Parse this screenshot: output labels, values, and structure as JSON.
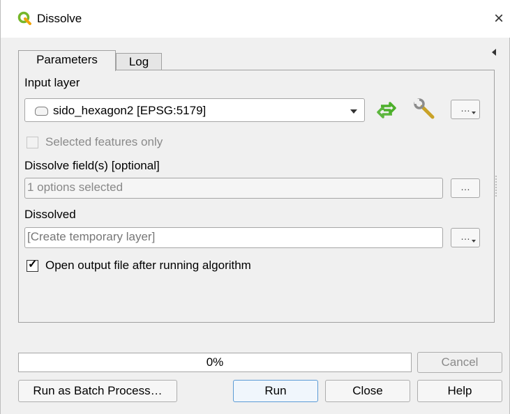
{
  "window": {
    "title": "Dissolve",
    "close_glyph": "×"
  },
  "tabs": [
    {
      "label": "Parameters",
      "active": true
    },
    {
      "label": "Log",
      "active": false
    }
  ],
  "params": {
    "input_layer_label": "Input layer",
    "input_layer_value": "sido_hexagon2 [EPSG:5179]",
    "selected_only_label": "Selected features only",
    "dissolve_field_label": "Dissolve field(s) [optional]",
    "dissolve_field_value": "1 options selected",
    "dissolved_label": "Dissolved",
    "dissolved_value": "[Create temporary layer]",
    "open_output_label": "Open output file after running algorithm",
    "dots": "…"
  },
  "footer": {
    "progress_percent": 0,
    "progress_text": "0%",
    "cancel_label": "Cancel",
    "batch_label": "Run as Batch Process…",
    "run_label": "Run",
    "close_label": "Close",
    "help_label": "Help"
  },
  "colors": {
    "qgis_green": "#76b72a",
    "accent_blue": "#5b9bd5"
  },
  "icons": [
    "qgis-logo-icon",
    "close-icon",
    "layer-polygon-icon",
    "iterate-icon",
    "wrench-icon",
    "collapse-arrow-icon"
  ]
}
